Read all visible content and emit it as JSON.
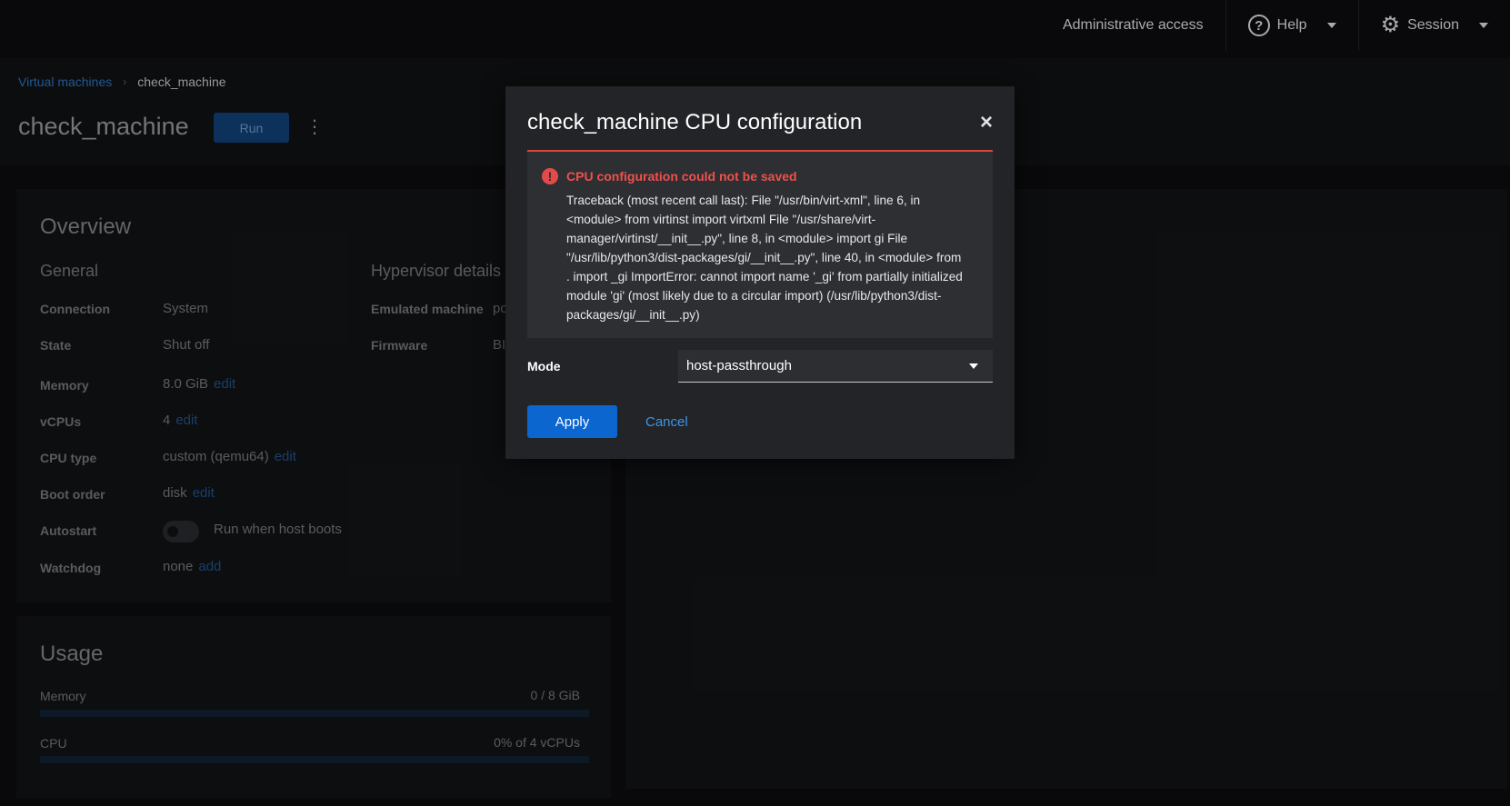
{
  "masthead": {
    "admin_access": "Administrative access",
    "help": "Help",
    "session": "Session"
  },
  "breadcrumb": {
    "parent": "Virtual machines",
    "current": "check_machine"
  },
  "page": {
    "title": "check_machine",
    "run_label": "Run",
    "kebab": "⋮"
  },
  "overview": {
    "title": "Overview",
    "general_title": "General",
    "hypervisor_title": "Hypervisor details",
    "connection_label": "Connection",
    "connection_value": "System",
    "state_label": "State",
    "state_value": "Shut off",
    "memory_label": "Memory",
    "memory_value": "8.0 GiB",
    "memory_edit": "edit",
    "vcpus_label": "vCPUs",
    "vcpus_value": "4",
    "vcpus_edit": "edit",
    "cputype_label": "CPU type",
    "cputype_value": "custom (qemu64)",
    "cputype_edit": "edit",
    "bootorder_label": "Boot order",
    "bootorder_value": "disk",
    "bootorder_edit": "edit",
    "autostart_label": "Autostart",
    "autostart_value": "Run when host boots",
    "watchdog_label": "Watchdog",
    "watchdog_value": "none",
    "watchdog_add": "add",
    "emulated_label": "Emulated machine",
    "emulated_value": "pc",
    "firmware_label": "Firmware",
    "firmware_value": "BI"
  },
  "usage": {
    "title": "Usage",
    "memory_label": "Memory",
    "memory_value": "0 / 8 GiB",
    "memory_fraction": 0,
    "cpu_label": "CPU",
    "cpu_value": "0% of 4 vCPUs",
    "cpu_fraction": 0
  },
  "modal": {
    "title": "check_machine CPU configuration",
    "close": "×",
    "alert_title": "CPU configuration could not be saved",
    "alert_body": "Traceback (most recent call last): File \"/usr/bin/virt-xml\", line 6, in <module> from virtinst import virtxml File \"/usr/share/virt-manager/virtinst/__init__.py\", line 8, in <module> import gi File \"/usr/lib/python3/dist-packages/gi/__init__.py\", line 40, in <module> from . import _gi ImportError: cannot import name '_gi' from partially initialized module 'gi' (most likely due to a circular import) (/usr/lib/python3/dist-packages/gi/__init__.py)",
    "mode_label": "Mode",
    "mode_value": "host-passthrough",
    "apply_label": "Apply",
    "cancel_label": "Cancel"
  },
  "colors": {
    "primary": "#0b66d0",
    "danger": "#f0504b",
    "link": "#3d95e8"
  }
}
